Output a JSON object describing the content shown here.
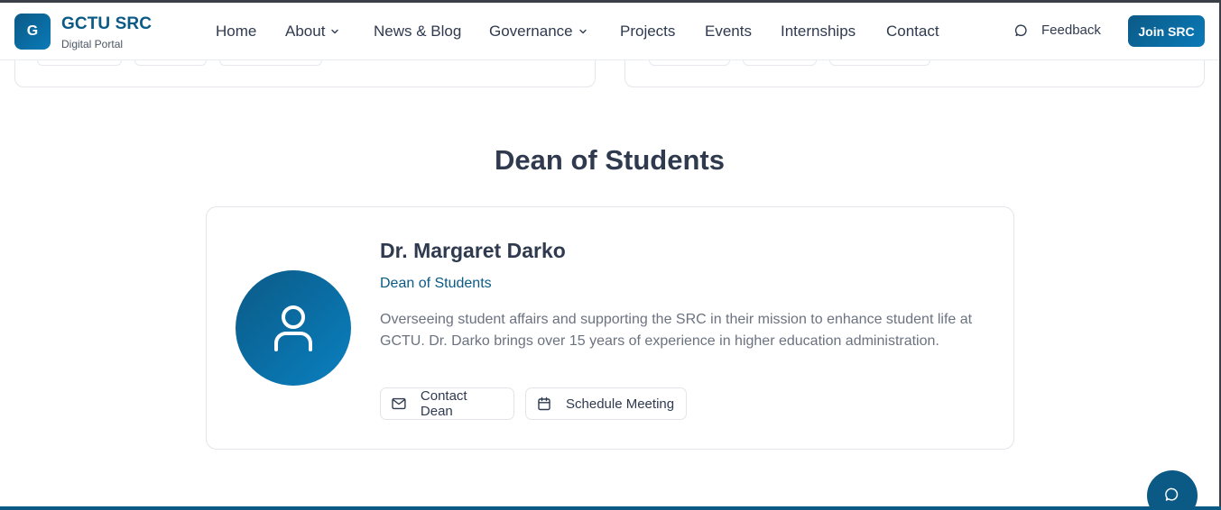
{
  "brand": {
    "logo_letter": "G",
    "title": "GCTU SRC",
    "subtitle": "Digital Portal"
  },
  "nav": {
    "items": [
      {
        "label": "Home",
        "has_dropdown": false
      },
      {
        "label": "About",
        "has_dropdown": true
      },
      {
        "label": "News & Blog",
        "has_dropdown": false
      },
      {
        "label": "Governance",
        "has_dropdown": true
      },
      {
        "label": "Projects",
        "has_dropdown": false
      },
      {
        "label": "Events",
        "has_dropdown": false
      },
      {
        "label": "Internships",
        "has_dropdown": false
      },
      {
        "label": "Contact",
        "has_dropdown": false
      }
    ],
    "feedback_label": "Feedback",
    "join_label": "Join SRC"
  },
  "section": {
    "title": "Dean of Students"
  },
  "dean": {
    "name": "Dr. Margaret Darko",
    "role": "Dean of Students",
    "bio": "Overseeing student affairs and supporting the SRC in their mission to enhance student life at GCTU. Dr. Darko brings over 15 years of experience in higher education administration.",
    "contact_label": "Contact Dean",
    "schedule_label": "Schedule Meeting"
  },
  "icons": {
    "feedback": "message-circle-icon",
    "avatar": "user-icon",
    "contact": "mail-icon",
    "schedule": "calendar-icon",
    "chat": "chat-bubble-icon"
  },
  "colors": {
    "brand": "#0b5a86",
    "brand_light": "#0a7ab8",
    "text": "#2f3a4f",
    "muted": "#6b7280",
    "border": "#e1e5ea"
  }
}
